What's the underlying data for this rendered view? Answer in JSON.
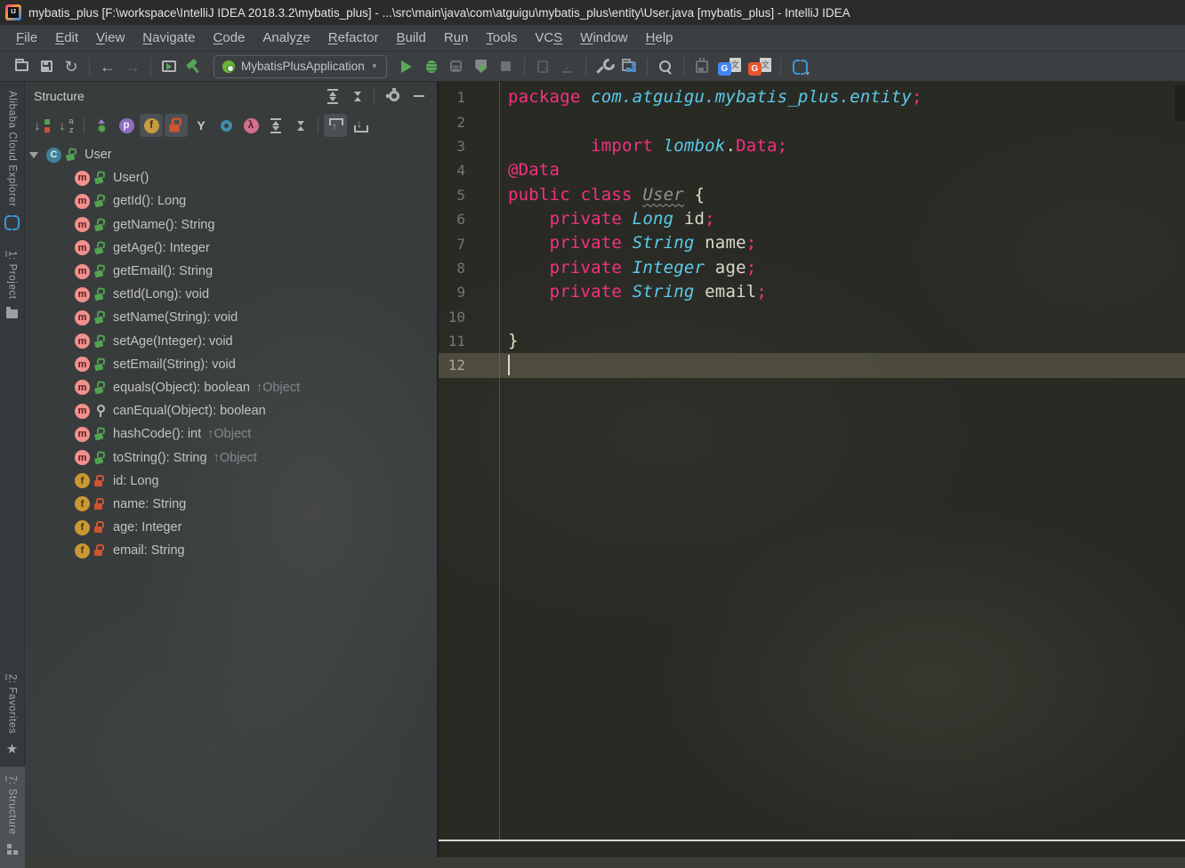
{
  "window": {
    "title": "mybatis_plus [F:\\workspace\\IntelliJ IDEA 2018.3.2\\mybatis_plus] - ...\\src\\main\\java\\com\\atguigu\\mybatis_plus\\entity\\User.java [mybatis_plus] - IntelliJ IDEA",
    "app_icon": "intellij-idea-logo"
  },
  "menu": {
    "items": [
      {
        "label": "File",
        "mnemonic": "F"
      },
      {
        "label": "Edit",
        "mnemonic": "E"
      },
      {
        "label": "View",
        "mnemonic": "V"
      },
      {
        "label": "Navigate",
        "mnemonic": "N"
      },
      {
        "label": "Code",
        "mnemonic": "C"
      },
      {
        "label": "Analyze",
        "mnemonic": "z"
      },
      {
        "label": "Refactor",
        "mnemonic": "R"
      },
      {
        "label": "Build",
        "mnemonic": "B"
      },
      {
        "label": "Run",
        "mnemonic": "u"
      },
      {
        "label": "Tools",
        "mnemonic": "T"
      },
      {
        "label": "VCS",
        "mnemonic": "S"
      },
      {
        "label": "Window",
        "mnemonic": "W"
      },
      {
        "label": "Help",
        "mnemonic": "H"
      }
    ]
  },
  "toolbar": {
    "run_config_label": "MybatisPlusApplication",
    "icons": [
      "open-icon",
      "save-icon",
      "sync-icon",
      "back-icon",
      "forward-icon",
      "run-anything-icon",
      "build-hammer-icon",
      "spring-boot-icon",
      "run-icon",
      "debug-icon",
      "coverage-icon",
      "profiler-icon",
      "stop-icon",
      "run-dim-icon",
      "download-dim-icon",
      "wrench-settings-icon",
      "project-structure-icon",
      "search-icon",
      "plugin-save-icon",
      "translate-blue-icon",
      "translate-orange-icon",
      "cloud-brackets-icon"
    ]
  },
  "left_stripe": {
    "top": [
      {
        "label": "Alibaba Cloud Explorer",
        "mnemonic": "",
        "icon": "cloud-explorer-icon",
        "selected": false
      },
      {
        "label": "1: Project",
        "mnemonic": "1",
        "icon": "project-folder-icon",
        "selected": false
      }
    ],
    "bottom": [
      {
        "label": "2: Favorites",
        "mnemonic": "2",
        "icon": "favorites-star-icon",
        "selected": false
      },
      {
        "label": "7: Structure",
        "mnemonic": "7",
        "icon": "structure-tool-icon",
        "selected": true
      }
    ]
  },
  "structure_panel": {
    "title": "Structure",
    "header_icons": [
      "expand-all-icon",
      "collapse-all-icon",
      "gear-icon",
      "hide-icon"
    ],
    "toolbar_icons": [
      "sort-by-visibility-icon",
      "sort-alphabetically-icon",
      "show-inherited-icon",
      "show-properties-icon",
      "show-fields-icon",
      "show-non-public-icon",
      "show-anonymous-classes-icon",
      "show-visitors-icon",
      "show-lambdas-icon",
      "expand-all-icon",
      "collapse-all-icon",
      "autoscroll-to-source-icon",
      "autoscroll-from-source-icon"
    ],
    "toolbar_letters": {
      "properties": "p",
      "fields": "f",
      "lambda": "λ",
      "anonymous": "Y"
    },
    "tree": [
      {
        "kind": "class",
        "vis": "public",
        "label": "User",
        "root": true
      },
      {
        "kind": "method",
        "vis": "public",
        "label": "User()"
      },
      {
        "kind": "method",
        "vis": "public",
        "label": "getId(): Long"
      },
      {
        "kind": "method",
        "vis": "public",
        "label": "getName(): String"
      },
      {
        "kind": "method",
        "vis": "public",
        "label": "getAge(): Integer"
      },
      {
        "kind": "method",
        "vis": "public",
        "label": "getEmail(): String"
      },
      {
        "kind": "method",
        "vis": "public",
        "label": "setId(Long): void"
      },
      {
        "kind": "method",
        "vis": "public",
        "label": "setName(String): void"
      },
      {
        "kind": "method",
        "vis": "public",
        "label": "setAge(Integer): void"
      },
      {
        "kind": "method",
        "vis": "public",
        "label": "setEmail(String): void"
      },
      {
        "kind": "method",
        "vis": "public",
        "label": "equals(Object): boolean",
        "suffix": "↑Object"
      },
      {
        "kind": "method",
        "vis": "package",
        "label": "canEqual(Object): boolean"
      },
      {
        "kind": "method",
        "vis": "public",
        "label": "hashCode(): int",
        "suffix": "↑Object"
      },
      {
        "kind": "method",
        "vis": "public",
        "label": "toString(): String",
        "suffix": "↑Object"
      },
      {
        "kind": "field",
        "vis": "private",
        "label": "id: Long"
      },
      {
        "kind": "field",
        "vis": "private",
        "label": "name: String"
      },
      {
        "kind": "field",
        "vis": "private",
        "label": "age: Integer"
      },
      {
        "kind": "field",
        "vis": "private",
        "label": "email: String"
      }
    ]
  },
  "editor": {
    "current_line": 12,
    "lines": [
      {
        "n": "1",
        "segs": [
          [
            "k",
            "package "
          ],
          [
            "t",
            "com.atguigu.mybatis_plus.entity"
          ],
          [
            "k",
            ";"
          ]
        ]
      },
      {
        "n": "2",
        "segs": []
      },
      {
        "n": "3",
        "segs": [
          [
            "p",
            "        "
          ],
          [
            "k",
            "import "
          ],
          [
            "t",
            "lombok"
          ],
          [
            "p",
            "."
          ],
          [
            "k",
            "Data"
          ],
          [
            "k",
            ";"
          ]
        ]
      },
      {
        "n": "4",
        "segs": [
          [
            "k",
            "@Data"
          ]
        ]
      },
      {
        "n": "5",
        "segs": [
          [
            "k",
            "public class "
          ],
          [
            "e",
            "User"
          ],
          [
            "b",
            " {"
          ]
        ]
      },
      {
        "n": "6",
        "segs": [
          [
            "p",
            "    "
          ],
          [
            "k",
            "private "
          ],
          [
            "t",
            "Long"
          ],
          [
            "p",
            " id"
          ],
          [
            "k",
            ";"
          ]
        ]
      },
      {
        "n": "7",
        "segs": [
          [
            "p",
            "    "
          ],
          [
            "k",
            "private "
          ],
          [
            "t",
            "String"
          ],
          [
            "p",
            " name"
          ],
          [
            "k",
            ";"
          ]
        ]
      },
      {
        "n": "8",
        "segs": [
          [
            "p",
            "    "
          ],
          [
            "k",
            "private "
          ],
          [
            "t",
            "Integer"
          ],
          [
            "p",
            " age"
          ],
          [
            "k",
            ";"
          ]
        ]
      },
      {
        "n": "9",
        "segs": [
          [
            "p",
            "    "
          ],
          [
            "k",
            "private "
          ],
          [
            "t",
            "String"
          ],
          [
            "p",
            " email"
          ],
          [
            "k",
            ";"
          ]
        ]
      },
      {
        "n": "10",
        "segs": []
      },
      {
        "n": "11",
        "segs": [
          [
            "b",
            "}"
          ]
        ]
      },
      {
        "n": "12",
        "segs": [],
        "current": true
      }
    ]
  },
  "colors": {
    "keyword_pink": "#f5317f",
    "type_cyan": "#59cbe8",
    "plain_text": "#d8d8cd",
    "editor_bg": "#2a2a25",
    "panel_bg": "#393c3d",
    "chrome_bg": "#3c3f41",
    "run_green": "#5ca75c",
    "field_ochre": "#ca9733",
    "method_salmon": "#f2908d",
    "class_blue": "#418099",
    "private_lock_orange": "#cf5430",
    "public_lock_green": "#53a352",
    "current_line_highlight": "#55534a"
  }
}
